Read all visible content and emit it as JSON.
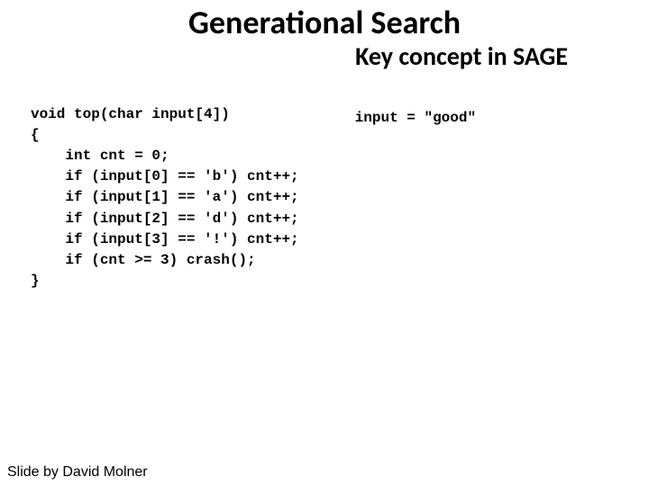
{
  "title": "Generational Search",
  "subtitle": "Key concept in SAGE",
  "code_lines": [
    "void top(char input[4])",
    "{",
    "    int cnt = 0;",
    "    if (input[0] == 'b') cnt++;",
    "    if (input[1] == 'a') cnt++;",
    "    if (input[2] == 'd') cnt++;",
    "    if (input[3] == '!') cnt++;",
    "    if (cnt >= 3) crash();",
    "}"
  ],
  "note": "input = \"good\"",
  "footer": "Slide by David Molner"
}
